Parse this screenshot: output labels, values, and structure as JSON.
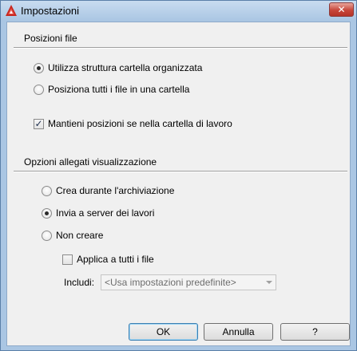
{
  "window": {
    "title": "Impostazioni",
    "close_label": "✕"
  },
  "file_positions": {
    "heading": "Posizioni file",
    "options": [
      {
        "label": "Utilizza struttura cartella organizzata",
        "checked": true
      },
      {
        "label": "Posiziona tutti i file in una cartella",
        "checked": false
      }
    ],
    "keep_positions_label": "Mantieni posizioni se nella cartella di lavoro",
    "keep_positions_checked": true
  },
  "attachments": {
    "heading": "Opzioni allegati visualizzazione",
    "options": [
      {
        "label": "Crea durante l'archiviazione",
        "checked": false
      },
      {
        "label": "Invia a server dei lavori",
        "checked": true
      },
      {
        "label": "Non creare",
        "checked": false
      }
    ],
    "apply_all_label": "Applica a tutti i file",
    "apply_all_checked": false,
    "include_label": "Includi:",
    "include_value": "<Usa impostazioni predefinite>"
  },
  "buttons": {
    "ok": "OK",
    "cancel": "Annulla",
    "help": "?"
  }
}
